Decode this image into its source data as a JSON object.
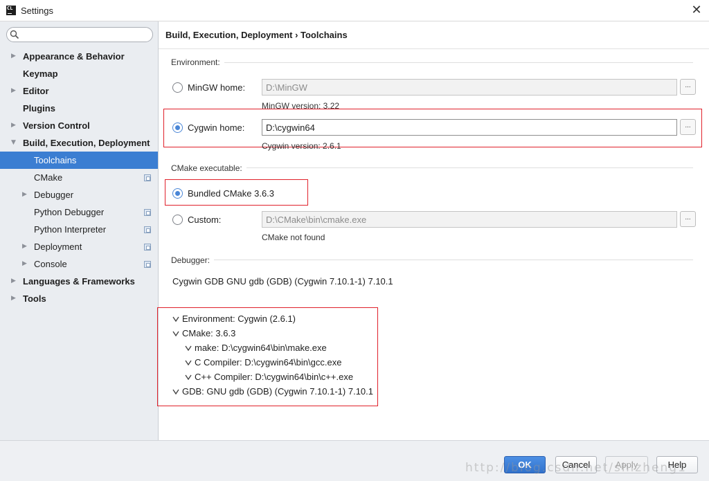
{
  "window": {
    "title": "Settings",
    "app_icon_text": "CL",
    "close_glyph": "✕"
  },
  "sidebar": {
    "search": {
      "value": "",
      "placeholder": ""
    },
    "items": [
      {
        "label": "Appearance & Behavior",
        "level": 0,
        "bold": true,
        "arrow": "right"
      },
      {
        "label": "Keymap",
        "level": 0,
        "bold": true,
        "arrow": ""
      },
      {
        "label": "Editor",
        "level": 0,
        "bold": true,
        "arrow": "right"
      },
      {
        "label": "Plugins",
        "level": 0,
        "bold": true,
        "arrow": ""
      },
      {
        "label": "Version Control",
        "level": 0,
        "bold": true,
        "arrow": "right"
      },
      {
        "label": "Build, Execution, Deployment",
        "level": 0,
        "bold": true,
        "arrow": "down"
      },
      {
        "label": "Toolchains",
        "level": 1,
        "bold": false,
        "arrow": "",
        "selected": true
      },
      {
        "label": "CMake",
        "level": 1,
        "bold": false,
        "arrow": "",
        "project_icon": true
      },
      {
        "label": "Debugger",
        "level": 1,
        "bold": false,
        "arrow": "right"
      },
      {
        "label": "Python Debugger",
        "level": 1,
        "bold": false,
        "arrow": "",
        "project_icon": true
      },
      {
        "label": "Python Interpreter",
        "level": 1,
        "bold": false,
        "arrow": "",
        "project_icon": true
      },
      {
        "label": "Deployment",
        "level": 1,
        "bold": false,
        "arrow": "right",
        "project_icon": true
      },
      {
        "label": "Console",
        "level": 1,
        "bold": false,
        "arrow": "right",
        "project_icon": true
      },
      {
        "label": "Languages & Frameworks",
        "level": 0,
        "bold": true,
        "arrow": "right"
      },
      {
        "label": "Tools",
        "level": 0,
        "bold": true,
        "arrow": "right"
      }
    ]
  },
  "content": {
    "breadcrumb": "Build, Execution, Deployment › Toolchains",
    "environment": {
      "title": "Environment:",
      "mingw": {
        "label": "MinGW home:",
        "path": "D:\\MinGW",
        "version": "MinGW version: 3.22",
        "checked": false
      },
      "cygwin": {
        "label": "Cygwin home:",
        "path": "D:\\cygwin64",
        "version": "Cygwin version: 2.6.1",
        "checked": true
      }
    },
    "cmake": {
      "title": "CMake executable:",
      "bundled": {
        "label": "Bundled CMake 3.6.3",
        "checked": true
      },
      "custom": {
        "label": "Custom:",
        "path": "D:\\CMake\\bin\\cmake.exe",
        "status": "CMake not found",
        "checked": false
      }
    },
    "debugger": {
      "title": "Debugger:",
      "value": "Cygwin GDB GNU gdb (GDB) (Cygwin 7.10.1-1) 7.10.1"
    },
    "checks": [
      {
        "text": "Environment: Cygwin (2.6.1)",
        "indent": 0
      },
      {
        "text": "CMake: 3.6.3",
        "indent": 0
      },
      {
        "text": "make: D:\\cygwin64\\bin\\make.exe",
        "indent": 1
      },
      {
        "text": "C Compiler: D:\\cygwin64\\bin\\gcc.exe",
        "indent": 1
      },
      {
        "text": "C++ Compiler: D:\\cygwin64\\bin\\c++.exe",
        "indent": 1
      },
      {
        "text": "GDB: GNU gdb (GDB) (Cygwin 7.10.1-1) 7.10.1",
        "indent": 0
      }
    ],
    "browse_label": "..."
  },
  "footer": {
    "ok": "OK",
    "cancel": "Cancel",
    "apply": "Apply",
    "help": "Help",
    "watermark": "http://blog.csdn.net/shizheng1"
  },
  "colors": {
    "accent": "#3b7ed2",
    "highlight_box": "#e0202a",
    "sidebar_bg": "#eaedf1"
  }
}
